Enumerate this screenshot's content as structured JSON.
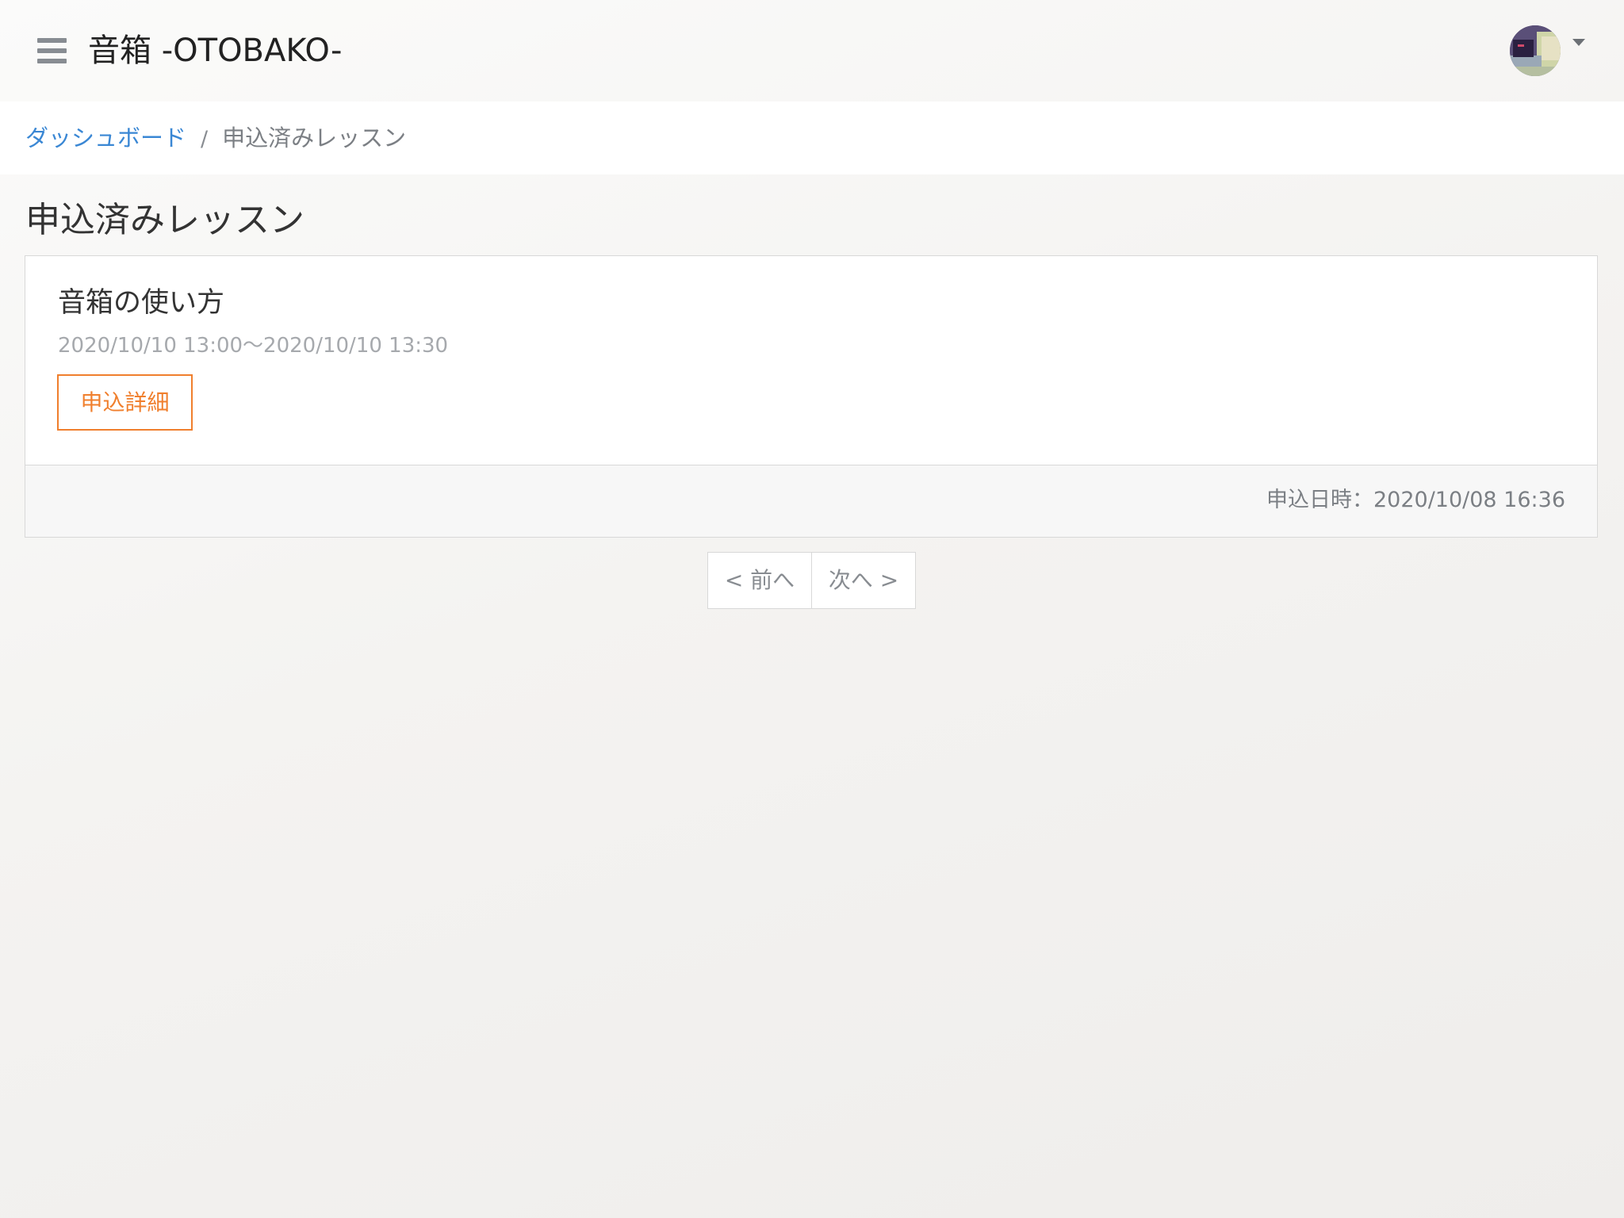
{
  "header": {
    "menu_icon": "hamburger-menu-icon",
    "brand": "音箱 -OTOBAKO-",
    "user_menu_icon": "caret-down-icon"
  },
  "breadcrumb": {
    "home_label": "ダッシュボード",
    "separator": "/",
    "current_label": "申込済みレッスン"
  },
  "page": {
    "title": "申込済みレッスン"
  },
  "lessons": [
    {
      "title": "音箱の使い方",
      "time_range": "2020/10/10 13:00〜2020/10/10 13:30",
      "detail_button_label": "申込詳細",
      "applied_at": "申込日時：2020/10/08 16:36"
    }
  ],
  "pagination": {
    "prev_label": "< 前へ",
    "next_label": "次へ >"
  },
  "colors": {
    "link": "#3a87d4",
    "accent": "#f07f2d",
    "muted_text": "#7b7f84"
  }
}
